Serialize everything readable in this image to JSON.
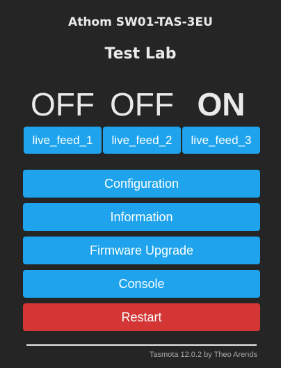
{
  "header": {
    "device_name": "Athom SW01-TAS-3EU",
    "friendly_name": "Test Lab"
  },
  "states": [
    {
      "label": "OFF",
      "on": false
    },
    {
      "label": "OFF",
      "on": false
    },
    {
      "label": "ON",
      "on": true
    }
  ],
  "toggles": [
    {
      "label": "live_feed_1"
    },
    {
      "label": "live_feed_2"
    },
    {
      "label": "live_feed_3"
    }
  ],
  "menu": {
    "configuration": "Configuration",
    "information": "Information",
    "firmware_upgrade": "Firmware Upgrade",
    "console": "Console",
    "restart": "Restart"
  },
  "footer": {
    "text": "Tasmota 12.0.2 by Theo Arends"
  },
  "colors": {
    "background": "#252525",
    "button": "#1fa3ec",
    "restart_button": "#d43535",
    "text": "#eaeaea"
  }
}
